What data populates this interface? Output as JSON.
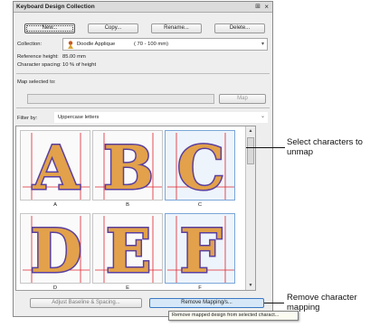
{
  "panel": {
    "title": "Keyboard Design Collection",
    "pin_glyph": "⊞",
    "close_glyph": "×"
  },
  "toolbar": {
    "new_label": "New...",
    "copy_label": "Copy...",
    "rename_label": "Rename...",
    "delete_label": "Delete..."
  },
  "collection": {
    "label": "Collection:",
    "value": "Doodle Applique",
    "range": "( 70 - 100 mm)"
  },
  "reference": {
    "height_label": "Reference height:",
    "height_value": "85.00 mm",
    "spacing_label": "Character spacing:",
    "spacing_value": "10 % of height"
  },
  "map": {
    "label": "Map selected to:",
    "input_value": "",
    "button_label": "Map"
  },
  "filter": {
    "label": "Filter by:",
    "value": "Uppercase letters"
  },
  "characters": [
    {
      "letter": "A",
      "caption": "A",
      "selected": false
    },
    {
      "letter": "B",
      "caption": "B",
      "selected": false
    },
    {
      "letter": "C",
      "caption": "C",
      "selected": true
    },
    {
      "letter": "D",
      "caption": "D",
      "selected": false
    },
    {
      "letter": "E",
      "caption": "E",
      "selected": false
    },
    {
      "letter": "F",
      "caption": "F",
      "selected": true
    }
  ],
  "bottom": {
    "adjust_label": "Adjust Baseline & Spacing...",
    "remove_label": "Remove Mapping/s..."
  },
  "tooltip": {
    "text": "Remove mapped design from selected charact..."
  },
  "callouts": {
    "select_text_1": "Select characters to",
    "select_text_2": "unmap",
    "remove_text_1": "Remove character",
    "remove_text_2": "mapping"
  },
  "colors": {
    "letter_fill": "#e2a14a",
    "letter_outline": "#5a3f9e",
    "guide_line": "#e0242c",
    "selection": "#7aa6d8"
  }
}
